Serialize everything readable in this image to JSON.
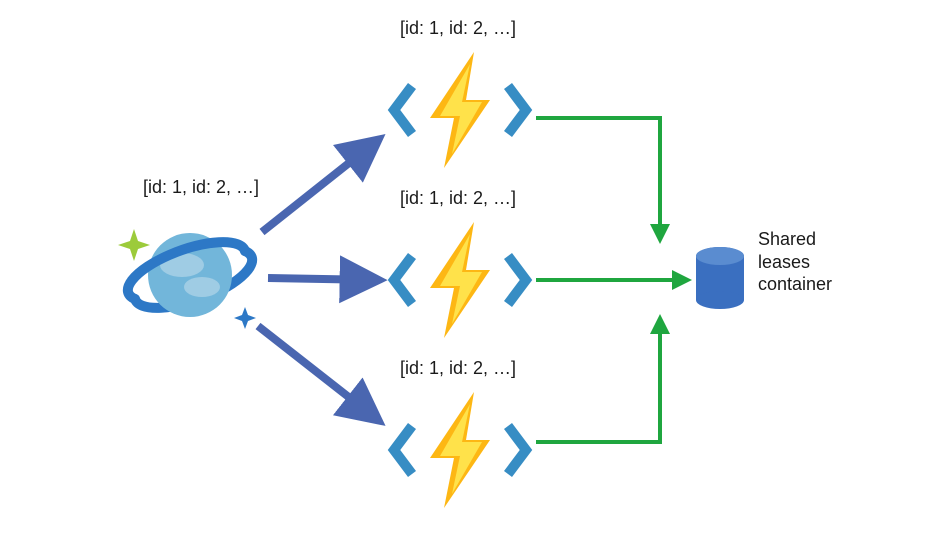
{
  "labels": {
    "source": "[id: 1, id: 2, …]",
    "fn1": "[id: 1, id: 2, …]",
    "fn2": "[id: 1, id: 2, …]",
    "fn3": "[id: 1, id: 2, …]",
    "db": "Shared\nleases\ncontainer"
  },
  "colors": {
    "blueArrow": "#4A66B0",
    "greenArrow": "#1FA63F",
    "dbFill": "#3A6FC0",
    "funcBracket": "#378DC4",
    "boltOuter": "#FDB714",
    "boltInner": "#FFE24A",
    "planetRing": "#2D78C6",
    "planetBody": "#72B6DA",
    "planetCloud": "#9FCCE4",
    "sparkleGreen": "#9CCB3B",
    "sparkleBlue": "#2D78C6"
  }
}
